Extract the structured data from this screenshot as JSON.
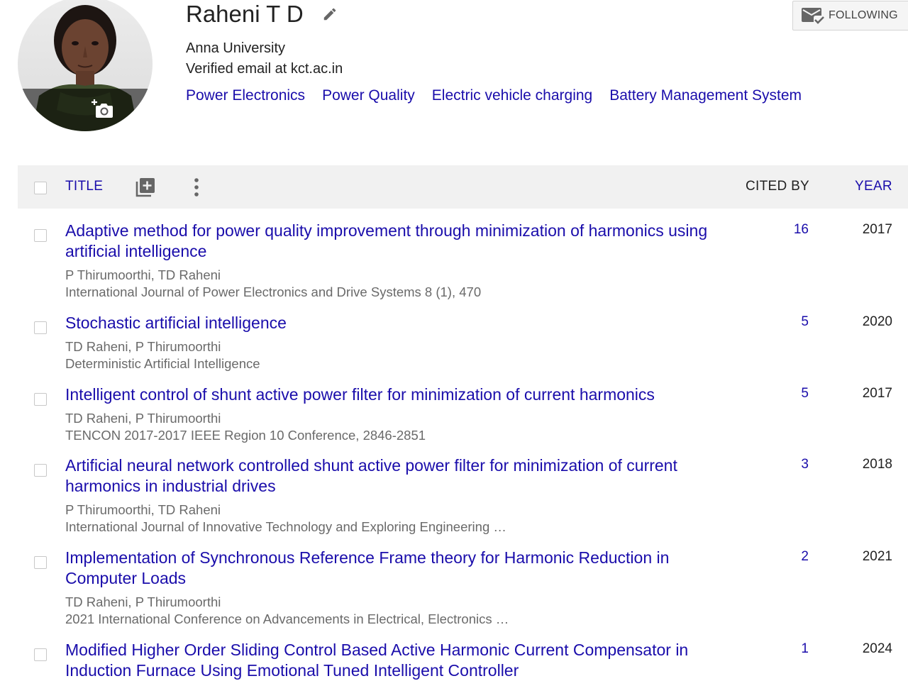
{
  "profile": {
    "name": "Raheni T D",
    "affiliation": "Anna University",
    "email": "Verified email at kct.ac.in",
    "interests": [
      "Power Electronics",
      "Power Quality",
      "Electric vehicle charging",
      "Battery Management System"
    ],
    "follow_label": "FOLLOWING"
  },
  "table": {
    "header": {
      "title": "TITLE",
      "cited_by": "CITED BY",
      "year": "YEAR"
    },
    "rows": [
      {
        "title": "Adaptive method for power quality improvement through minimization of harmonics using artificial intelligence",
        "authors": "P Thirumoorthi, TD Raheni",
        "venue": "International Journal of Power Electronics and Drive Systems 8 (1), 470",
        "cited_by": "16",
        "year": "2017"
      },
      {
        "title": "Stochastic artificial intelligence",
        "authors": "TD Raheni, P Thirumoorthi",
        "venue": "Deterministic Artificial Intelligence",
        "cited_by": "5",
        "year": "2020"
      },
      {
        "title": "Intelligent control of shunt active power filter for minimization of current harmonics",
        "authors": "TD Raheni, P Thirumoorthi",
        "venue": "TENCON 2017-2017 IEEE Region 10 Conference, 2846-2851",
        "cited_by": "5",
        "year": "2017"
      },
      {
        "title": "Artificial neural network controlled shunt active power filter for minimization of current harmonics in industrial drives",
        "authors": "P Thirumoorthi, TD Raheni",
        "venue": "International Journal of Innovative Technology and Exploring Engineering …",
        "cited_by": "3",
        "year": "2018"
      },
      {
        "title": "Implementation of Synchronous Reference Frame theory for Harmonic Reduction in Computer Loads",
        "authors": "TD Raheni, P Thirumoorthi",
        "venue": "2021 International Conference on Advancements in Electrical, Electronics …",
        "cited_by": "2",
        "year": "2021"
      },
      {
        "title": "Modified Higher Order Sliding Control Based Active Harmonic Current Compensator in Induction Furnace Using Emotional Tuned Intelligent Controller",
        "authors": "",
        "venue": "",
        "cited_by": "1",
        "year": "2024"
      }
    ]
  },
  "colors": {
    "link": "#1a0dab",
    "text": "#222222",
    "muted": "#6a6a6a",
    "header_bg": "#f1f1f1"
  },
  "icons": {
    "edit": "pencil-icon",
    "follow": "mail-check-icon",
    "add_photo": "camera-plus-icon",
    "add_article": "add-box-icon",
    "more": "more-vert-icon"
  }
}
